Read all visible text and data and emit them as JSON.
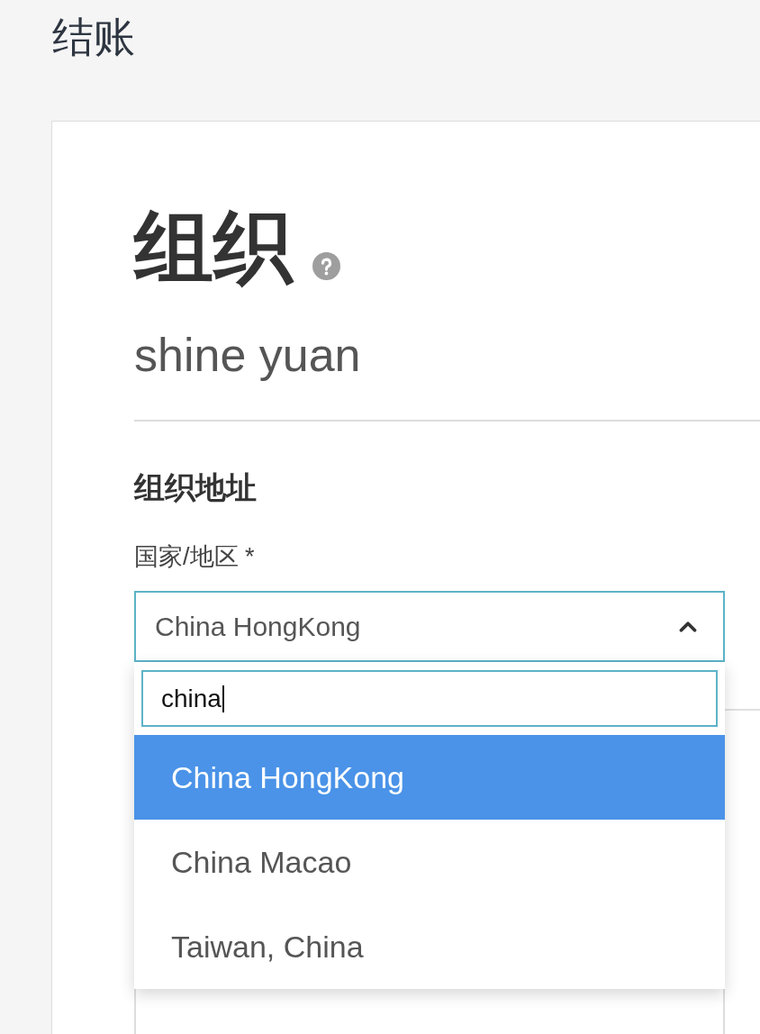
{
  "page": {
    "title": "结账"
  },
  "organization": {
    "heading": "组织",
    "name": "shine yuan"
  },
  "address_section": {
    "heading": "组织地址",
    "country_field": {
      "label": "国家/地区 *",
      "value": "China HongKong",
      "expanded": true,
      "search": {
        "value": "china"
      },
      "options": [
        {
          "label": "China HongKong",
          "selected": true
        },
        {
          "label": "China Macao",
          "selected": false
        },
        {
          "label": "Taiwan, China",
          "selected": false
        }
      ]
    }
  }
}
